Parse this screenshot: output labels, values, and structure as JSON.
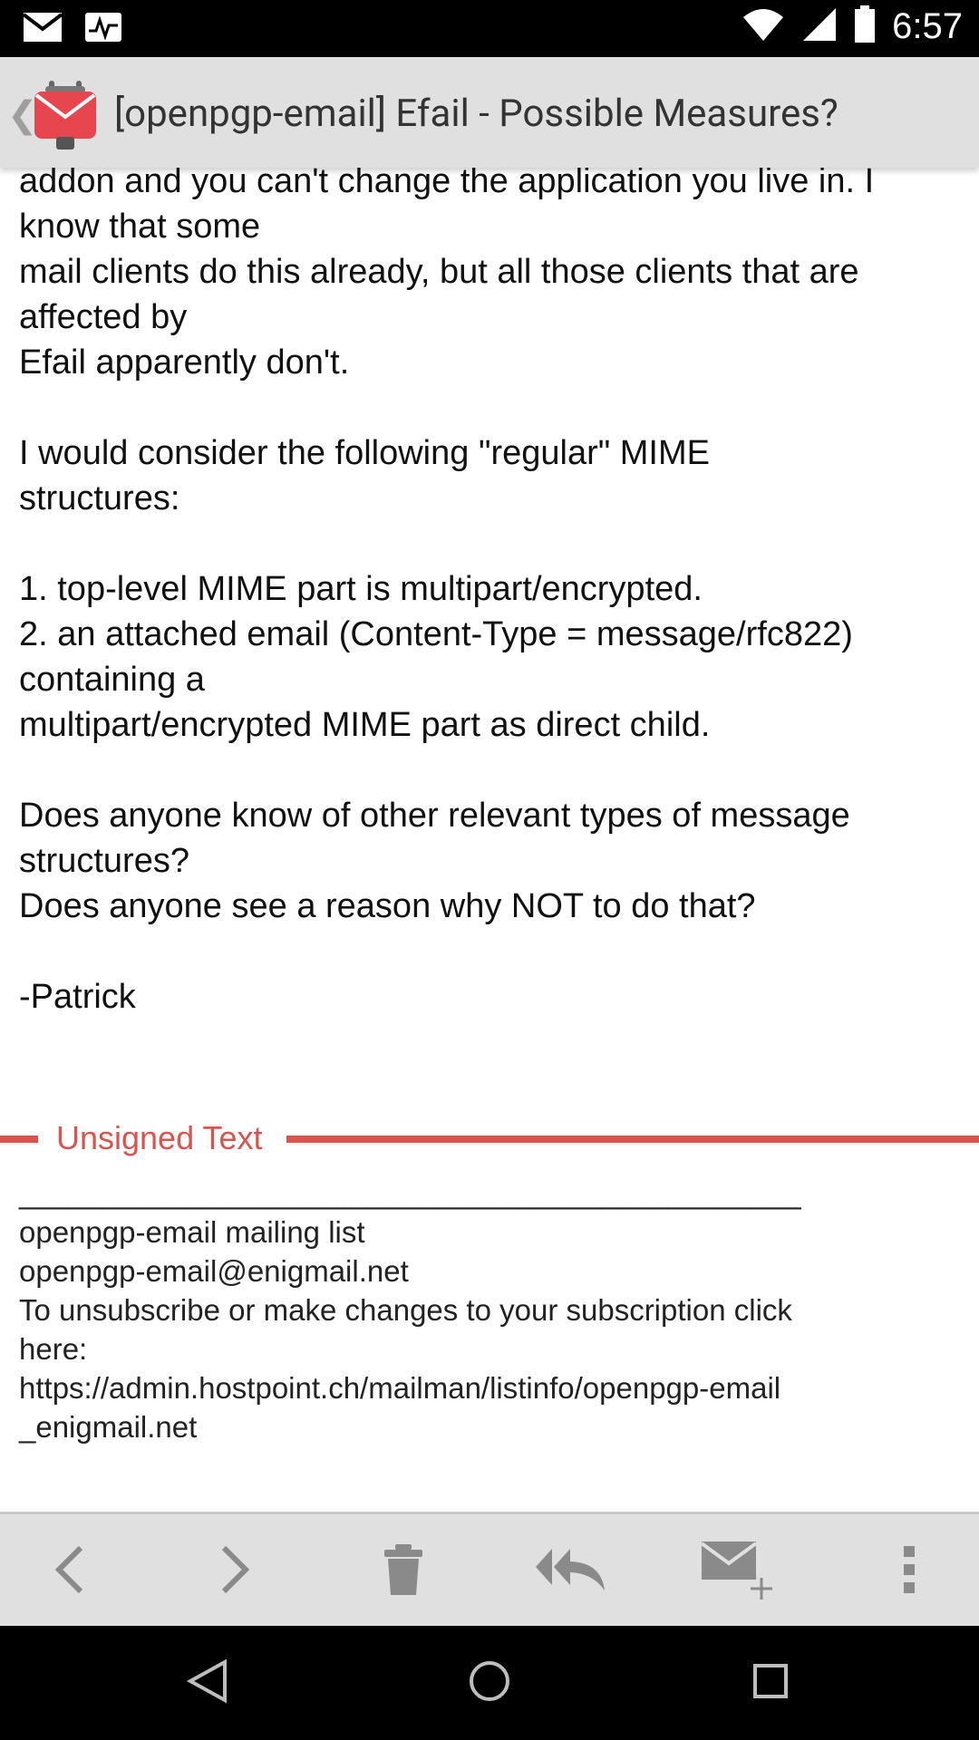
{
  "status_bar": {
    "time": "6:57",
    "icons": [
      "mail-icon",
      "activity-icon",
      "wifi-icon",
      "signal-icon",
      "battery-icon"
    ]
  },
  "app_bar": {
    "title": "[openpgp-email] Efail - Possible Measures?"
  },
  "message": {
    "body": "addon and you can't change the application you live in. I\nknow that some\nmail clients do this already, but all those clients that are\naffected by\nEfail apparently don't.\n\nI would consider the following \"regular\" MIME\nstructures:\n\n1. top-level MIME part is multipart/encrypted.\n2. an attached email (Content-Type = message/rfc822)\ncontaining a\nmultipart/encrypted MIME part as direct child.\n\nDoes anyone know of other relevant types of message\nstructures?\nDoes anyone see a reason why NOT to do that?\n\n-Patrick",
    "unsigned_label": "Unsigned Text",
    "footer": "_______________________________________________\nopenpgp-email mailing list\nopenpgp-email@enigmail.net\nTo unsubscribe or make changes to your subscription click\nhere:\nhttps://admin.hostpoint.ch/mailman/listinfo/openpgp-email\n_enigmail.net"
  },
  "toolbar": {
    "buttons": [
      "previous-icon",
      "next-icon",
      "delete-icon",
      "reply-all-icon",
      "compose-icon",
      "more-icon"
    ]
  },
  "colors": {
    "accent_red": "#d9534f",
    "toolbar_bg": "#e0e0e0",
    "icon_gray": "#8a8a8a"
  }
}
